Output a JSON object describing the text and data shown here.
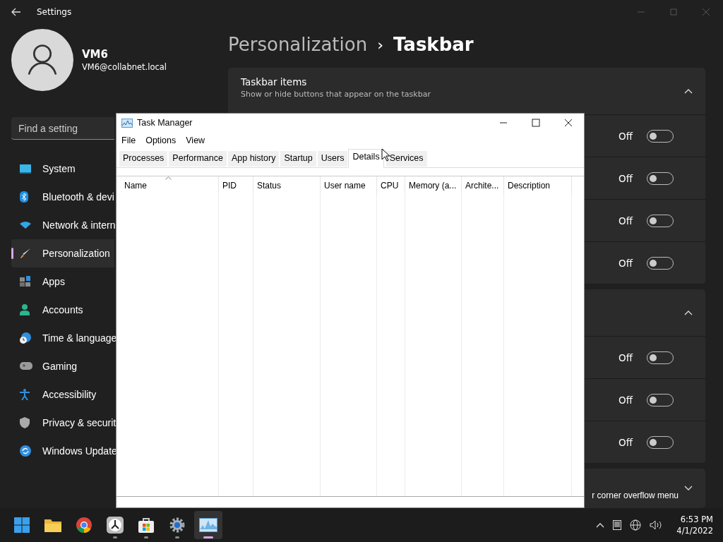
{
  "settings": {
    "title": "Settings",
    "user": {
      "name": "VM6",
      "email": "VM6@collabnet.local"
    },
    "search": {
      "placeholder": "Find a setting"
    },
    "nav": [
      {
        "label": "System",
        "selected": false
      },
      {
        "label": "Bluetooth & devi",
        "selected": false
      },
      {
        "label": "Network & intern",
        "selected": false
      },
      {
        "label": "Personalization",
        "selected": true
      },
      {
        "label": "Apps",
        "selected": false
      },
      {
        "label": "Accounts",
        "selected": false
      },
      {
        "label": "Time & language",
        "selected": false
      },
      {
        "label": "Gaming",
        "selected": false
      },
      {
        "label": "Accessibility",
        "selected": false
      },
      {
        "label": "Privacy & securit",
        "selected": false
      },
      {
        "label": "Windows Update",
        "selected": false
      }
    ],
    "breadcrumb": {
      "parent": "Personalization",
      "separator": "›",
      "current": "Taskbar"
    },
    "cards": [
      {
        "title": "Taskbar items",
        "subtitle": "Show or hide buttons that appear on the taskbar",
        "expanded": true,
        "rows": [
          {
            "state": "Off",
            "on": false
          },
          {
            "state": "Off",
            "on": false
          },
          {
            "state": "Off",
            "on": false
          },
          {
            "state": "Off",
            "on": false
          }
        ]
      },
      {
        "expanded": true,
        "rows": [
          {
            "state": "Off",
            "on": false
          },
          {
            "state": "Off",
            "on": false
          },
          {
            "state": "Off",
            "on": false
          }
        ]
      },
      {
        "title": "r corner overflow menu",
        "expanded": false
      }
    ]
  },
  "task_manager": {
    "title": "Task Manager",
    "menu": [
      "File",
      "Options",
      "View"
    ],
    "tabs": [
      {
        "label": "Processes",
        "selected": false
      },
      {
        "label": "Performance",
        "selected": false
      },
      {
        "label": "App history",
        "selected": false
      },
      {
        "label": "Startup",
        "selected": false
      },
      {
        "label": "Users",
        "selected": false
      },
      {
        "label": "Details",
        "selected": true
      },
      {
        "label": "Services",
        "selected": false
      }
    ],
    "columns": [
      "Name",
      "PID",
      "Status",
      "User name",
      "CPU",
      "Memory (a...",
      "Archite...",
      "Description"
    ]
  },
  "taskbar": {
    "apps": [
      {
        "running": false,
        "active": false
      },
      {
        "running": false,
        "active": false
      },
      {
        "running": false,
        "active": false
      },
      {
        "running": true,
        "active": false
      },
      {
        "running": true,
        "active": false
      },
      {
        "running": true,
        "active": false
      },
      {
        "running": true,
        "active": true
      }
    ],
    "time": "6:53 PM",
    "date": "4/1/2022"
  }
}
